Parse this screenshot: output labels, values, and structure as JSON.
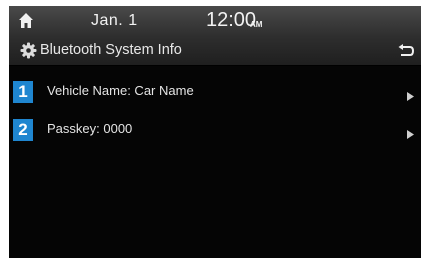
{
  "status_bar": {
    "date": "Jan.  1",
    "time": "12:00",
    "ampm": "AM",
    "home_icon": "home-icon"
  },
  "title_bar": {
    "title": "Bluetooth System Info",
    "settings_icon": "gear-icon",
    "back_icon": "back-arrow-icon"
  },
  "list": {
    "items": [
      {
        "number": "1",
        "label": "Vehicle Name: Car Name",
        "arrow_icon": "chevron-right-icon"
      },
      {
        "number": "2",
        "label": "Passkey: 0000",
        "arrow_icon": "chevron-right-icon"
      }
    ]
  },
  "colors": {
    "screen_background": "#050505",
    "number_badge": "#1f86d0",
    "text": "#e4e4e4"
  }
}
